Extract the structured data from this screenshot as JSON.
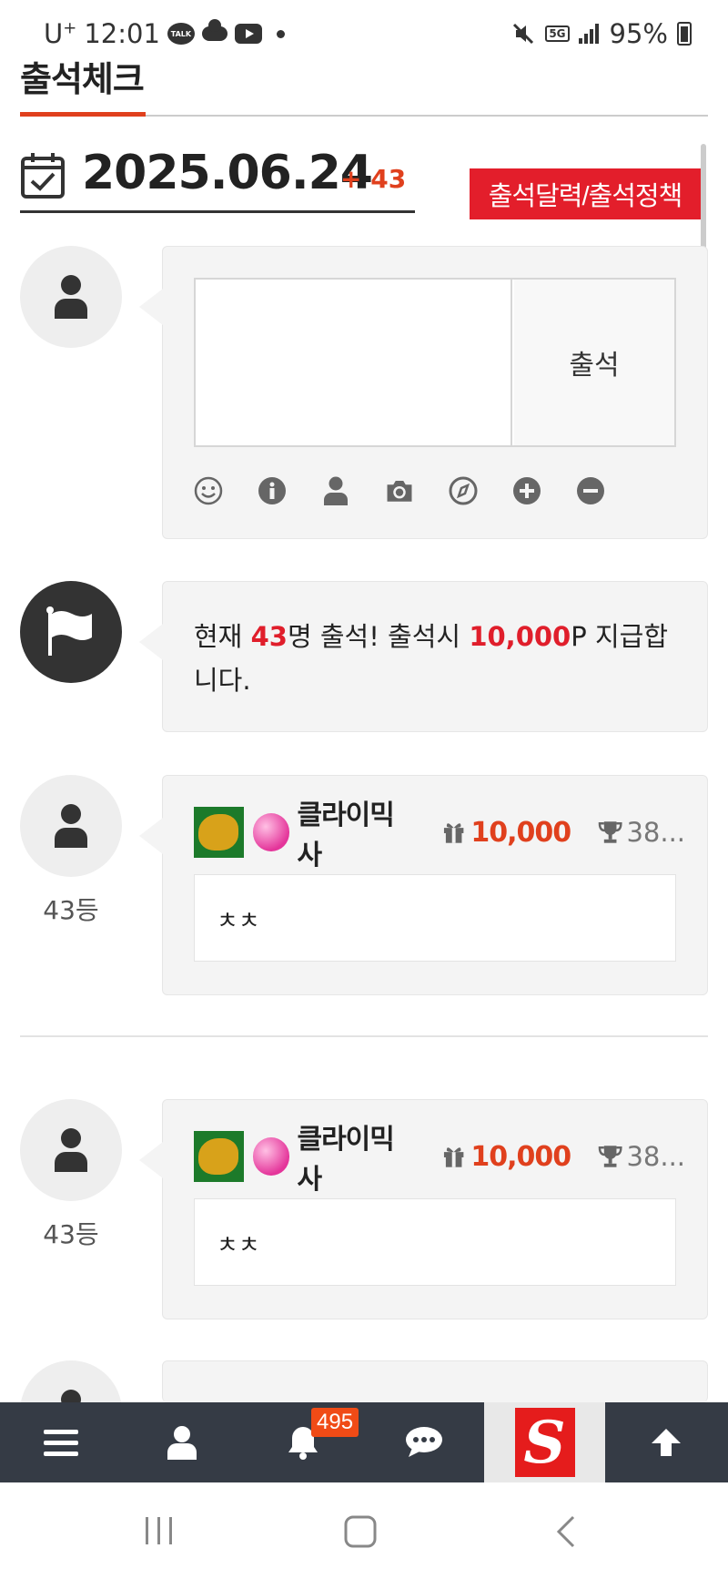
{
  "status_bar": {
    "carrier": "U",
    "carrier_sup": "+",
    "time": "12:01",
    "talk_label": "TALK",
    "network_label": "5G",
    "battery": "95%"
  },
  "header": {
    "title": "출석체크"
  },
  "date_section": {
    "date": "2025.06.24",
    "count": "+ 43",
    "calendar_button": "출석달력/출석정책"
  },
  "compose": {
    "textarea_value": "",
    "submit_label": "출석",
    "tools": [
      "smile-icon",
      "info-icon",
      "user-icon",
      "camera-icon",
      "compass-icon",
      "plus-circle-icon",
      "minus-circle-icon"
    ]
  },
  "notice": {
    "prefix": "현재 ",
    "count": "43",
    "mid": "명 출석! 출석시 ",
    "points": "10,000",
    "suffix": "P 지급합니다."
  },
  "entries": [
    {
      "rank": "43등",
      "username": "클라이믹사",
      "points": "10,000",
      "trophy": "38...",
      "comment": "ㅊㅊ"
    },
    {
      "rank": "43등",
      "username": "클라이믹사",
      "points": "10,000",
      "trophy": "38...",
      "comment": "ㅊㅊ"
    }
  ],
  "bottom_bar": {
    "notification_count": "495",
    "logo_letter": "S",
    "items": [
      "menu-icon",
      "user-icon",
      "bell-icon",
      "chat-icon",
      "site-logo",
      "arrow-up-icon"
    ]
  },
  "colors": {
    "accent_red": "#e31e2b",
    "accent_orange": "#e0401d",
    "bottom_bar": "#353b45"
  }
}
